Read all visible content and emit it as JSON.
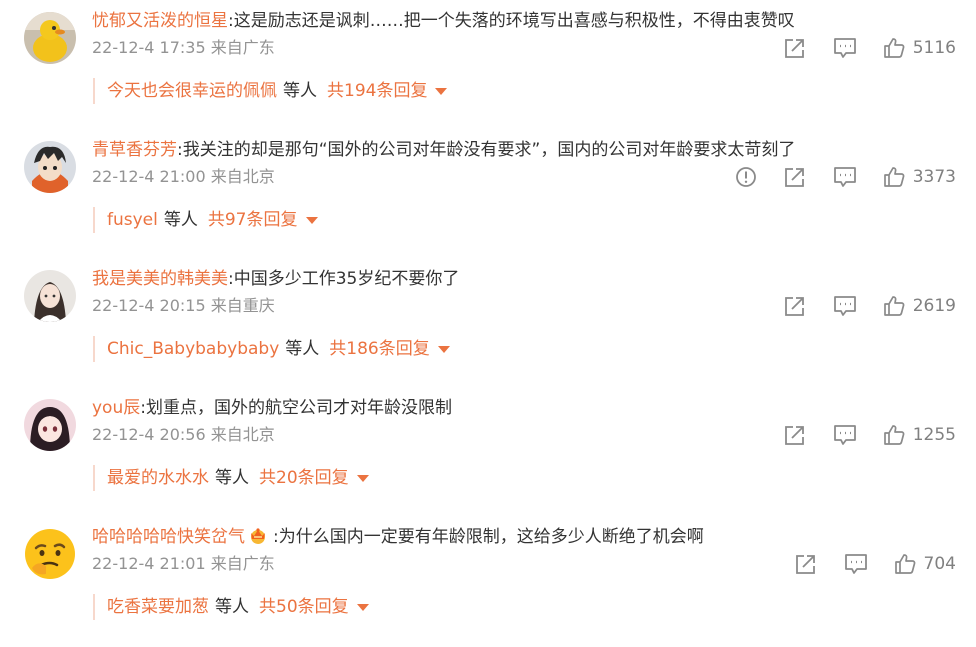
{
  "comments": [
    {
      "user": "忧郁又活泼的恒星",
      "text": "这是励志还是讽刺……把一个失落的环境写出喜感与积极性，不得由衷赞叹",
      "time": "22-12-4 17:35",
      "location": "来自广东",
      "likes": "5116",
      "reply_user": "今天也会很幸运的佩佩",
      "reply_etc": "等人",
      "reply_total": "共194条回复",
      "avatar_icon": "yellow-duck-avatar"
    },
    {
      "user": "青草香芬芳",
      "text": "我关注的却是那句“国外的公司对年龄没有要求”，国内的公司对年龄要求太苛刻了",
      "time": "22-12-4 21:00",
      "location": "来自北京",
      "likes": "3373",
      "reply_user": "fusyel",
      "reply_etc": "等人",
      "reply_total": "共97条回复",
      "avatar_icon": "anime-boy-avatar"
    },
    {
      "user": "我是美美的韩美美",
      "text": "中国多少工作35岁纪不要你了",
      "time": "22-12-4 20:15",
      "location": "来自重庆",
      "likes": "2619",
      "reply_user": "Chic_Babybabybaby",
      "reply_etc": "等人",
      "reply_total": "共186条回复",
      "avatar_icon": "girl-photo-avatar"
    },
    {
      "user": "you辰",
      "text": "划重点，国外的航空公司才对年龄没限制",
      "time": "22-12-4 20:56",
      "location": "来自北京",
      "likes": "1255",
      "reply_user": "最爱的水水水",
      "reply_etc": "等人",
      "reply_total": "共20条回复",
      "avatar_icon": "anime-girl-avatar"
    },
    {
      "user": "哈哈哈哈哈快笑岔气",
      "text": "为什么国内一定要有年龄限制，这给多少人断绝了机会啊",
      "time": "22-12-4 21:01",
      "location": "来自广东",
      "likes": "704",
      "reply_user": "吃香菜要加葱",
      "reply_etc": "等人",
      "reply_total": "共50条回复",
      "avatar_icon": "thinking-emoji-avatar"
    }
  ],
  "colors": {
    "accent": "#eb7340",
    "text": "#333333",
    "meta": "#939393",
    "icon": "#8a8a8a"
  }
}
